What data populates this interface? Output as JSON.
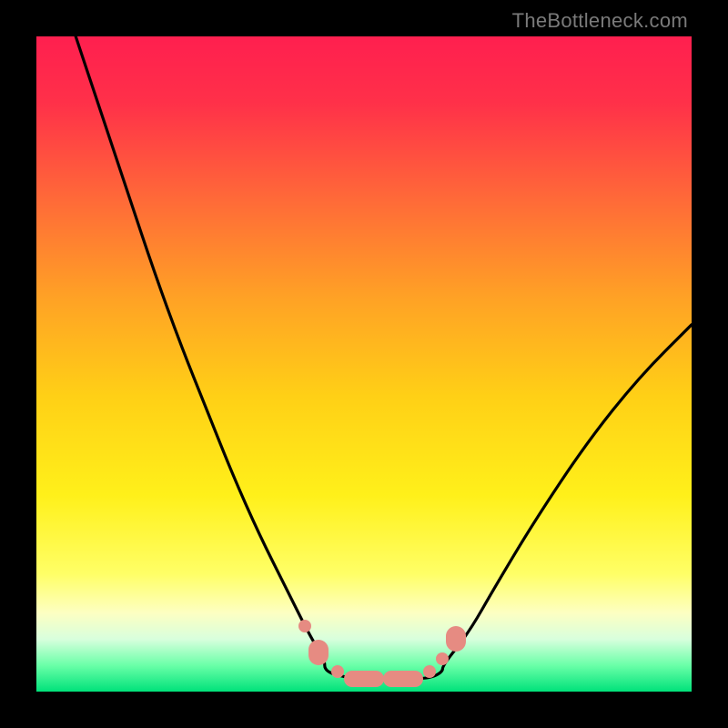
{
  "watermark": "TheBottleneck.com",
  "colors": {
    "frame_bg": "#000000",
    "gradient_stops": [
      {
        "offset": 0.0,
        "color": "#ff1f4f"
      },
      {
        "offset": 0.1,
        "color": "#ff3049"
      },
      {
        "offset": 0.25,
        "color": "#ff6a38"
      },
      {
        "offset": 0.4,
        "color": "#ffa225"
      },
      {
        "offset": 0.55,
        "color": "#ffd016"
      },
      {
        "offset": 0.7,
        "color": "#fff01a"
      },
      {
        "offset": 0.82,
        "color": "#ffff66"
      },
      {
        "offset": 0.88,
        "color": "#fdffc2"
      },
      {
        "offset": 0.92,
        "color": "#d8ffdd"
      },
      {
        "offset": 0.96,
        "color": "#6affa8"
      },
      {
        "offset": 1.0,
        "color": "#00e27a"
      }
    ],
    "curve_stroke": "#000000",
    "marker_fill": "#e68b82"
  },
  "chart_data": {
    "type": "line",
    "title": "",
    "xlabel": "",
    "ylabel": "",
    "xlim": [
      0,
      100
    ],
    "ylim": [
      0,
      100
    ],
    "grid": false,
    "legend": false,
    "annotations": [
      "TheBottleneck.com"
    ],
    "series": [
      {
        "name": "left-curve",
        "x": [
          6,
          10,
          14,
          18,
          22,
          26,
          30,
          34,
          38,
          42,
          44
        ],
        "y": [
          100,
          88,
          76,
          64,
          53,
          43,
          33,
          24,
          16,
          8,
          5
        ]
      },
      {
        "name": "bottom-flat",
        "x": [
          44,
          48,
          52,
          56,
          60,
          62
        ],
        "y": [
          3,
          2,
          2,
          2,
          2,
          3
        ]
      },
      {
        "name": "right-curve",
        "x": [
          62,
          66,
          70,
          76,
          84,
          92,
          100
        ],
        "y": [
          4,
          9,
          16,
          26,
          38,
          48,
          56
        ]
      }
    ],
    "markers": [
      {
        "x": 41,
        "y": 10,
        "size": "small"
      },
      {
        "x": 43,
        "y": 6,
        "size": "large"
      },
      {
        "x": 46,
        "y": 3,
        "size": "small"
      },
      {
        "x": 50,
        "y": 2,
        "size": "pill"
      },
      {
        "x": 56,
        "y": 2,
        "size": "pill"
      },
      {
        "x": 60,
        "y": 3,
        "size": "small"
      },
      {
        "x": 62,
        "y": 5,
        "size": "small"
      },
      {
        "x": 64,
        "y": 8,
        "size": "large"
      }
    ]
  }
}
